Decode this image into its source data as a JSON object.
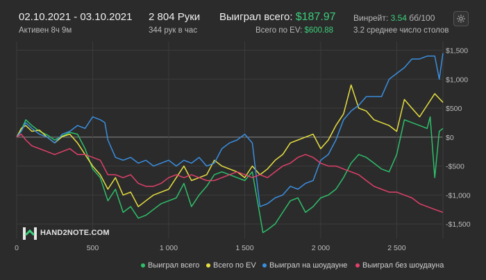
{
  "header": {
    "date_range": "02.10.2021 - 03.10.2021",
    "active": "Активен 8ч 9м",
    "hands": "2 804 Руки",
    "hands_per_hour": "344 рук в час",
    "won_total_label": "Выиграл всего:",
    "won_total_value": "$187.97",
    "ev_total_label": "Всего по EV:",
    "ev_total_value": "$600.88",
    "winrate_label": "Винрейт:",
    "winrate_value": "3.54",
    "winrate_unit": "бб/100",
    "avg_tables": "3.2 среднее число столов"
  },
  "settings_icon": "gear-icon",
  "logo_text": "HAND2NOTE.COM",
  "colors": {
    "background": "#2b2b2b",
    "grid": "#3c3c3c",
    "zero_line": "#8a8a8a",
    "accent_green": "#3ccf7c"
  },
  "chart_data": {
    "type": "line",
    "x_ticks": [
      {
        "value": 0,
        "label": "0"
      },
      {
        "value": 500,
        "label": "500"
      },
      {
        "value": 1000,
        "label": "1 000"
      },
      {
        "value": 1500,
        "label": "1 500"
      },
      {
        "value": 2000,
        "label": "2 000"
      },
      {
        "value": 2500,
        "label": "2 500"
      }
    ],
    "y_ticks": [
      {
        "value": 1500,
        "label": "$1,500"
      },
      {
        "value": 1000,
        "label": "$1,000"
      },
      {
        "value": 500,
        "label": "$500"
      },
      {
        "value": 0,
        "label": "$0"
      },
      {
        "value": -500,
        "label": "-$500"
      },
      {
        "value": -1000,
        "label": "-$1,000"
      },
      {
        "value": -1500,
        "label": "-$1,500"
      }
    ],
    "xlim": [
      0,
      2804
    ],
    "ylim": [
      -1750,
      1650
    ],
    "grid": true,
    "legend_position": "bottom-right",
    "series": [
      {
        "name": "Выиграл всего",
        "color": "#2ebf6a",
        "x": [
          0,
          30,
          60,
          100,
          150,
          200,
          250,
          300,
          350,
          400,
          450,
          500,
          550,
          600,
          650,
          700,
          750,
          800,
          850,
          900,
          950,
          1000,
          1050,
          1100,
          1150,
          1200,
          1250,
          1300,
          1350,
          1400,
          1450,
          1500,
          1550,
          1600,
          1620,
          1650,
          1700,
          1750,
          1800,
          1850,
          1900,
          1950,
          2000,
          2050,
          2100,
          2150,
          2200,
          2250,
          2300,
          2350,
          2400,
          2450,
          2500,
          2550,
          2600,
          2650,
          2700,
          2720,
          2750,
          2780,
          2804
        ],
        "y": [
          0,
          120,
          300,
          200,
          100,
          40,
          -50,
          20,
          80,
          50,
          -200,
          -550,
          -700,
          -1100,
          -900,
          -1300,
          -1200,
          -1400,
          -1350,
          -1250,
          -1150,
          -1100,
          -1050,
          -800,
          -1200,
          -1000,
          -850,
          -650,
          -600,
          -650,
          -700,
          -750,
          -600,
          -1350,
          -1650,
          -1600,
          -1500,
          -1300,
          -1100,
          -1050,
          -1300,
          -1200,
          -1050,
          -1000,
          -900,
          -700,
          -450,
          -300,
          -350,
          -450,
          -550,
          -600,
          -300,
          300,
          250,
          200,
          150,
          350,
          -700,
          100,
          150
        ]
      },
      {
        "name": "Всего по EV",
        "color": "#e8e040",
        "x": [
          0,
          30,
          60,
          100,
          150,
          200,
          250,
          300,
          350,
          400,
          450,
          500,
          550,
          600,
          650,
          700,
          750,
          800,
          850,
          900,
          950,
          1000,
          1050,
          1100,
          1150,
          1200,
          1250,
          1300,
          1350,
          1400,
          1450,
          1500,
          1550,
          1600,
          1650,
          1700,
          1750,
          1800,
          1850,
          1900,
          1950,
          2000,
          2050,
          2100,
          2150,
          2200,
          2250,
          2300,
          2350,
          2400,
          2450,
          2500,
          2550,
          2600,
          2650,
          2700,
          2750,
          2804
        ],
        "y": [
          0,
          150,
          200,
          100,
          120,
          0,
          -100,
          10,
          50,
          -100,
          -300,
          -500,
          -650,
          -900,
          -700,
          -1000,
          -950,
          -1200,
          -1100,
          -1000,
          -950,
          -900,
          -700,
          -500,
          -750,
          -700,
          -650,
          -400,
          -500,
          -550,
          -600,
          -700,
          -500,
          -650,
          -550,
          -400,
          -300,
          -100,
          -50,
          0,
          50,
          -200,
          -50,
          200,
          400,
          900,
          500,
          450,
          300,
          250,
          200,
          100,
          650,
          500,
          350,
          550,
          750,
          600
        ]
      },
      {
        "name": "Выиграл на шоудауне",
        "color": "#3a8fe0",
        "x": [
          0,
          30,
          60,
          100,
          150,
          200,
          250,
          300,
          350,
          400,
          450,
          500,
          550,
          580,
          600,
          650,
          700,
          750,
          800,
          850,
          900,
          950,
          1000,
          1050,
          1100,
          1150,
          1200,
          1250,
          1300,
          1350,
          1400,
          1450,
          1500,
          1550,
          1600,
          1650,
          1700,
          1750,
          1800,
          1850,
          1900,
          1950,
          2000,
          2050,
          2100,
          2150,
          2200,
          2250,
          2300,
          2350,
          2400,
          2450,
          2500,
          2550,
          2600,
          2650,
          2700,
          2750,
          2780,
          2804
        ],
        "y": [
          0,
          100,
          250,
          150,
          50,
          0,
          -100,
          50,
          100,
          200,
          150,
          350,
          300,
          250,
          -50,
          -350,
          -400,
          -350,
          -450,
          -400,
          -500,
          -450,
          -400,
          -500,
          -400,
          -450,
          -350,
          -500,
          -450,
          -200,
          -100,
          -50,
          50,
          -100,
          -1200,
          -1150,
          -1050,
          -1000,
          -850,
          -900,
          -800,
          -750,
          -400,
          -300,
          -50,
          300,
          450,
          550,
          700,
          700,
          700,
          1000,
          1100,
          1200,
          1350,
          1350,
          1400,
          1400,
          1000,
          1450
        ]
      },
      {
        "name": "Выиграл без шоудауна",
        "color": "#e0406a",
        "x": [
          0,
          30,
          60,
          100,
          150,
          200,
          250,
          300,
          350,
          400,
          450,
          500,
          550,
          600,
          650,
          700,
          750,
          800,
          850,
          900,
          950,
          1000,
          1050,
          1100,
          1150,
          1200,
          1250,
          1300,
          1350,
          1400,
          1450,
          1500,
          1550,
          1600,
          1650,
          1700,
          1750,
          1800,
          1850,
          1900,
          1950,
          2000,
          2050,
          2100,
          2150,
          2200,
          2250,
          2300,
          2350,
          2400,
          2450,
          2500,
          2550,
          2600,
          2650,
          2700,
          2750,
          2804
        ],
        "y": [
          0,
          50,
          -50,
          -150,
          -200,
          -250,
          -300,
          -250,
          -200,
          -300,
          -300,
          -350,
          -400,
          -650,
          -650,
          -700,
          -650,
          -800,
          -850,
          -850,
          -800,
          -700,
          -650,
          -700,
          -650,
          -700,
          -750,
          -750,
          -700,
          -650,
          -600,
          -650,
          -700,
          -650,
          -700,
          -600,
          -500,
          -450,
          -350,
          -300,
          -350,
          -450,
          -500,
          -500,
          -550,
          -600,
          -650,
          -750,
          -850,
          -900,
          -950,
          -950,
          -1000,
          -1050,
          -1150,
          -1200,
          -1250,
          -1300
        ]
      }
    ]
  }
}
